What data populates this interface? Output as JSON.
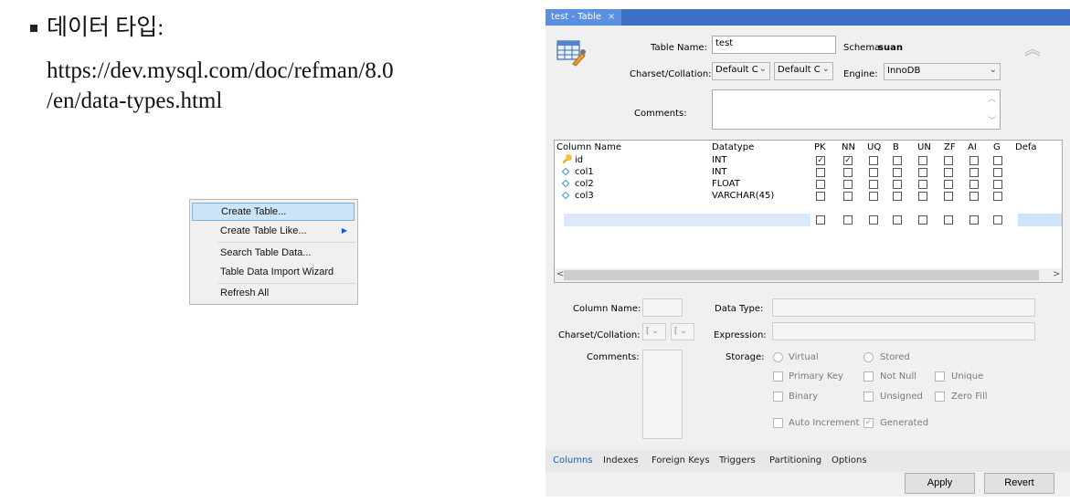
{
  "note": {
    "line1": "데이터 타입:",
    "line2": "https://dev.mysql.com/doc/refman/8.0",
    "line3": "/en/data-types.html"
  },
  "context_menu": {
    "items": [
      {
        "label": "Create Table...",
        "selected": true
      },
      {
        "label": "Create Table Like...",
        "submenu": true
      },
      {
        "label": "Search Table Data..."
      },
      {
        "label": "Table Data Import Wizard"
      },
      {
        "label": "Refresh All"
      }
    ]
  },
  "editor": {
    "tab": {
      "label": "test - Table",
      "close": "×"
    },
    "table_name_label": "Table Name:",
    "table_name_value": "test",
    "schema_label": "Schema:",
    "schema_value": "suan",
    "charset_label": "Charset/Collation:",
    "charset_value": "Default C",
    "collation_value": "Default C",
    "engine_label": "Engine:",
    "engine_value": "InnoDB",
    "comments_label": "Comments:",
    "grid": {
      "headers": [
        "Column Name",
        "Datatype",
        "PK",
        "NN",
        "UQ",
        "B",
        "UN",
        "ZF",
        "AI",
        "G",
        "Defa"
      ],
      "rows": [
        {
          "name": "id",
          "type": "INT",
          "icon": "key-icon",
          "pk": true,
          "nn": true
        },
        {
          "name": "col1",
          "type": "INT",
          "icon": "column-diamond-icon",
          "pk": false,
          "nn": false
        },
        {
          "name": "col2",
          "type": "FLOAT",
          "icon": "column-diamond-icon",
          "pk": false,
          "nn": false
        },
        {
          "name": "col3",
          "type": "VARCHAR(45)",
          "icon": "column-diamond-icon",
          "pk": false,
          "nn": false
        }
      ]
    },
    "detail": {
      "column_name_label": "Column Name:",
      "data_type_label": "Data Type:",
      "charset_label": "Charset/Collation:",
      "charset_short": "[",
      "expression_label": "Expression:",
      "comments_label": "Comments:",
      "storage_label": "Storage:",
      "virtual": "Virtual",
      "stored": "Stored",
      "primary_key": "Primary Key",
      "not_null": "Not Null",
      "unique": "Unique",
      "binary": "Binary",
      "unsigned": "Unsigned",
      "zero_fill": "Zero Fill",
      "auto_increment": "Auto Increment",
      "generated": "Generated",
      "generated_checked": true
    },
    "bottom_tabs": [
      "Columns",
      "Indexes",
      "Foreign Keys",
      "Triggers",
      "Partitioning",
      "Options"
    ],
    "apply_label": "Apply",
    "revert_label": "Revert"
  }
}
